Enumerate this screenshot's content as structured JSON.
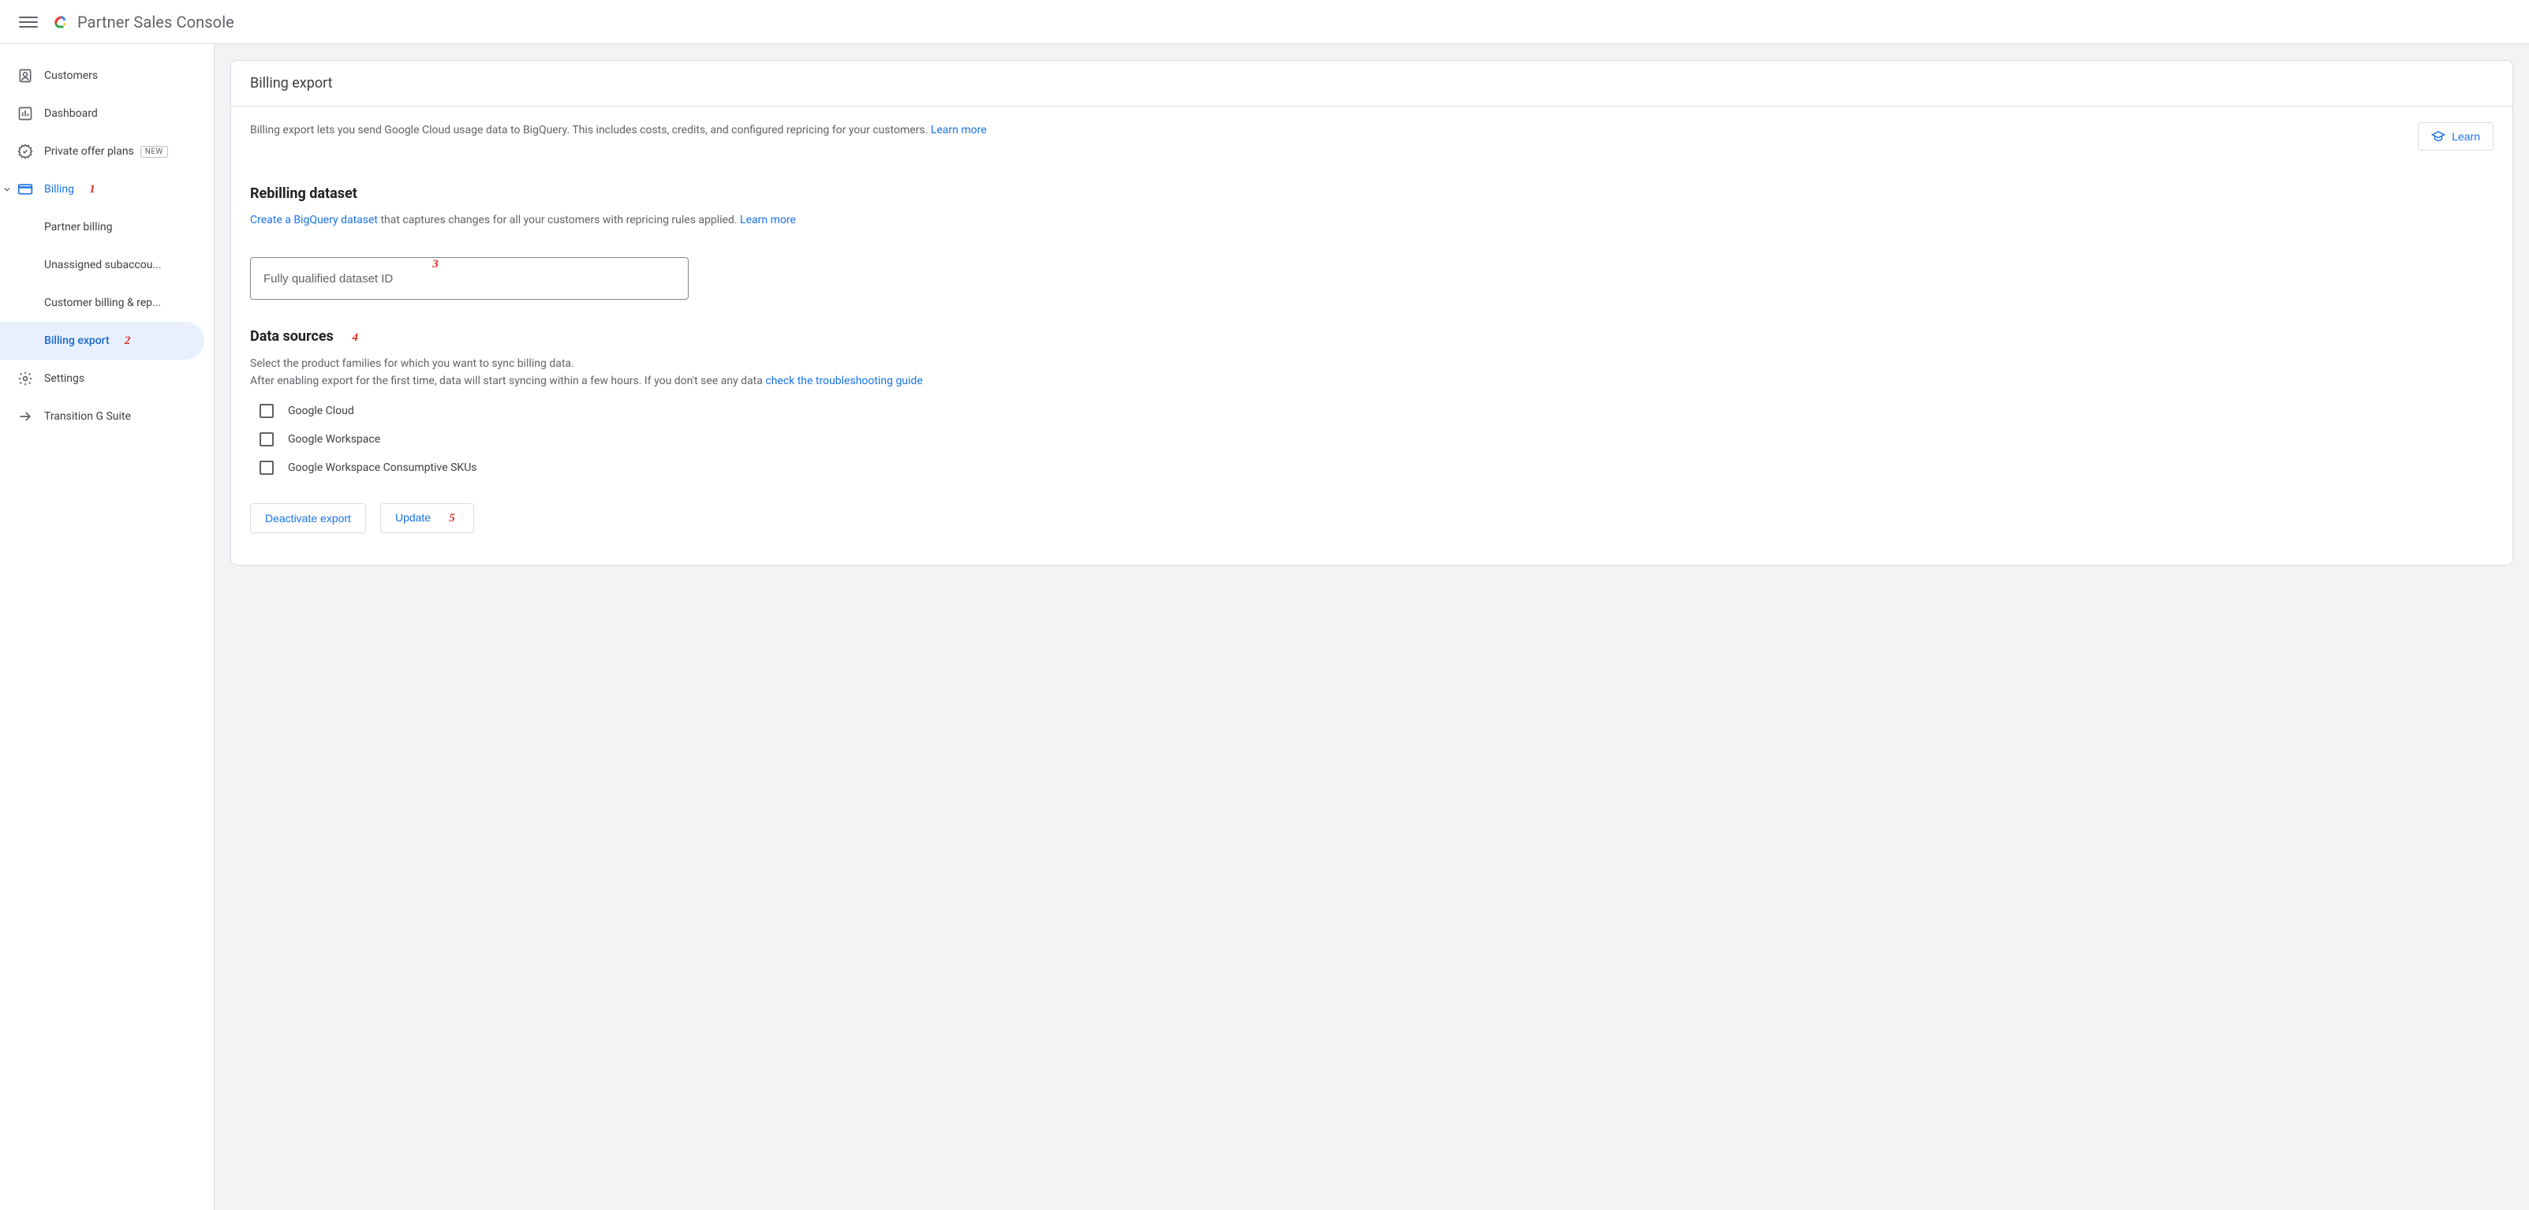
{
  "header": {
    "brand": "Partner Sales Console"
  },
  "sidebar": {
    "customers": "Customers",
    "dashboard": "Dashboard",
    "private_offer": "Private offer plans",
    "badge_new": "NEW",
    "billing": "Billing",
    "partner_billing": "Partner billing",
    "unassigned": "Unassigned subaccou...",
    "customer_billing": "Customer billing & rep...",
    "billing_export": "Billing export",
    "settings": "Settings",
    "transition": "Transition G Suite"
  },
  "page": {
    "title": "Billing export",
    "intro_text": "Billing export lets you send Google Cloud usage data to BigQuery. This includes costs, credits, and configured repricing for your customers. ",
    "intro_learn": "Learn more",
    "learn_button": "Learn",
    "rebilling_heading": "Rebilling dataset",
    "rebilling_link": "Create a BigQuery dataset",
    "rebilling_mid": " that captures changes for all your customers with repricing rules applied. ",
    "rebilling_learn": "Learn more",
    "dataset_placeholder": "Fully qualified dataset ID",
    "sources_heading": "Data sources",
    "sources_line1": "Select the product families for which you want to sync billing data.",
    "sources_line2a": "After enabling export for the first time, data will start syncing within a few hours. If you don't see any data ",
    "sources_line2b": "check the troubleshooting guide",
    "data_sources": [
      {
        "label": "Google Cloud"
      },
      {
        "label": "Google Workspace"
      },
      {
        "label": "Google Workspace Consumptive SKUs"
      }
    ],
    "deactivate": "Deactivate export",
    "update": "Update"
  },
  "annotations": {
    "a1": "1",
    "a2": "2",
    "a3": "3",
    "a4": "4",
    "a5": "5"
  }
}
